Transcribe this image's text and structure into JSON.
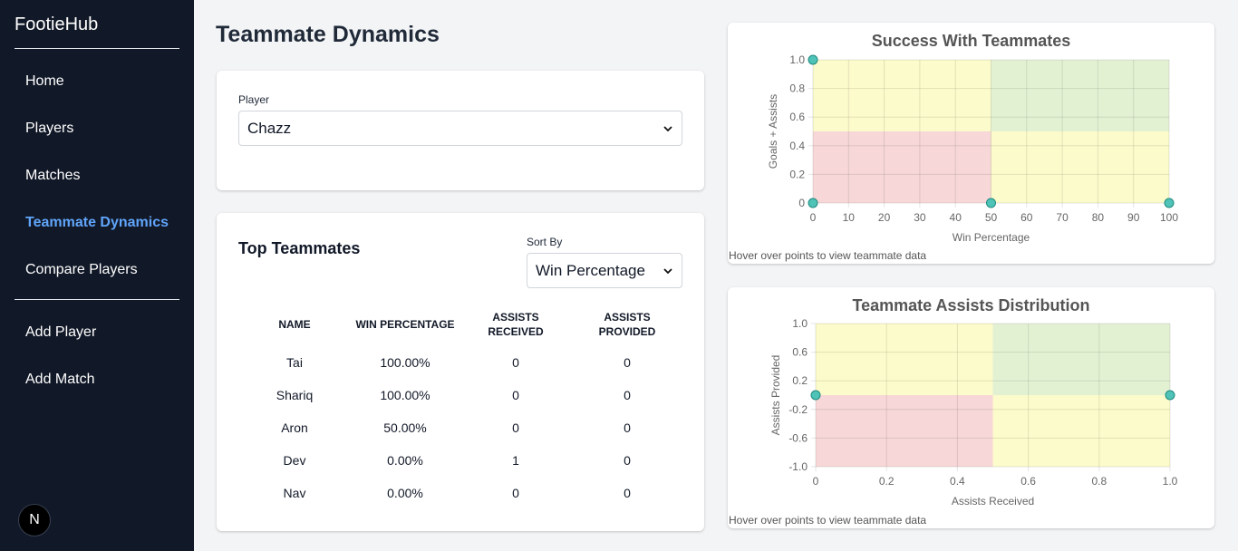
{
  "app": {
    "brand": "FootieHub",
    "logo_letter": "N"
  },
  "nav": {
    "primary": [
      {
        "label": "Home",
        "active": false
      },
      {
        "label": "Players",
        "active": false
      },
      {
        "label": "Matches",
        "active": false
      },
      {
        "label": "Teammate Dynamics",
        "active": true
      },
      {
        "label": "Compare Players",
        "active": false
      }
    ],
    "secondary": [
      {
        "label": "Add Player"
      },
      {
        "label": "Add Match"
      }
    ]
  },
  "page": {
    "title": "Teammate Dynamics"
  },
  "player_select": {
    "label": "Player",
    "value": "Chazz"
  },
  "top_teammates": {
    "title": "Top Teammates",
    "sort_label": "Sort By",
    "sort_value": "Win Percentage",
    "columns": [
      {
        "line1": "NAME",
        "line2": ""
      },
      {
        "line1": "WIN PERCENTAGE",
        "line2": ""
      },
      {
        "line1": "ASSISTS",
        "line2": "RECEIVED"
      },
      {
        "line1": "ASSISTS",
        "line2": "PROVIDED"
      }
    ],
    "rows": [
      {
        "name": "Tai",
        "win": "100.00%",
        "received": "0",
        "provided": "0"
      },
      {
        "name": "Shariq",
        "win": "100.00%",
        "received": "0",
        "provided": "0"
      },
      {
        "name": "Aron",
        "win": "50.00%",
        "received": "0",
        "provided": "0"
      },
      {
        "name": "Dev",
        "win": "0.00%",
        "received": "1",
        "provided": "0"
      },
      {
        "name": "Nav",
        "win": "0.00%",
        "received": "0",
        "provided": "0"
      }
    ]
  },
  "colors": {
    "sidebar_bg": "#111827",
    "active_nav": "#60a5fa",
    "quad_green": "#e3f1d3",
    "quad_yellow": "#fcfbcb",
    "quad_red": "#f7d7d7",
    "point_fill": "#4fc3b7",
    "point_stroke": "#1f8a7f"
  },
  "chart_data": [
    {
      "type": "scatter",
      "title": "Success With Teammates",
      "xlabel": "Win Percentage",
      "ylabel": "Goals + Assists",
      "xlim": [
        0,
        100
      ],
      "ylim": [
        0,
        1
      ],
      "xticks": [
        "0",
        "10",
        "20",
        "30",
        "40",
        "50",
        "60",
        "70",
        "80",
        "90",
        "100"
      ],
      "yticks": [
        "0",
        "0.2",
        "0.4",
        "0.6",
        "0.8",
        "1.0"
      ],
      "grid": true,
      "quadrant_split": [
        50,
        0.5
      ],
      "points": [
        {
          "x": 0,
          "y": 1
        },
        {
          "x": 0,
          "y": 0
        },
        {
          "x": 50,
          "y": 0
        },
        {
          "x": 100,
          "y": 0
        }
      ],
      "hint": "Hover over points to view teammate data"
    },
    {
      "type": "scatter",
      "title": "Teammate Assists Distribution",
      "xlabel": "Assists Received",
      "ylabel": "Assists Provided",
      "xlim": [
        0,
        1
      ],
      "ylim": [
        -1,
        1
      ],
      "xticks": [
        "0",
        "0.2",
        "0.4",
        "0.6",
        "0.8",
        "1.0"
      ],
      "yticks": [
        "-1.0",
        "-0.6",
        "-0.2",
        "0.2",
        "0.6",
        "1.0"
      ],
      "grid": true,
      "quadrant_split": [
        0.5,
        0
      ],
      "points": [
        {
          "x": 0,
          "y": 0
        },
        {
          "x": 1,
          "y": 0
        }
      ],
      "hint": "Hover over points to view teammate data"
    }
  ]
}
